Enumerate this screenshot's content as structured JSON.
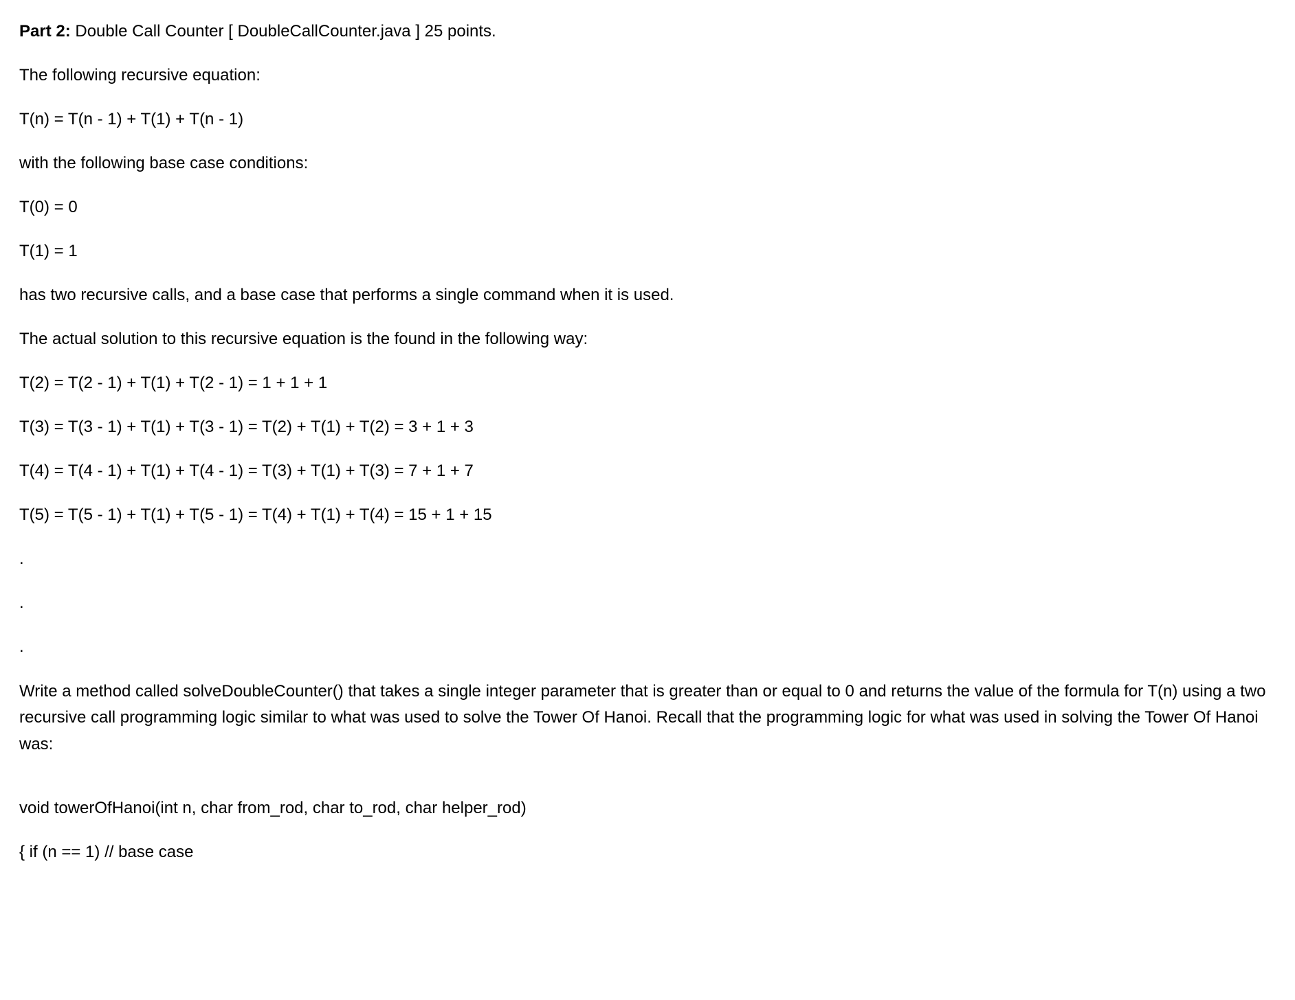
{
  "header": {
    "partLabel": "Part 2:",
    "title": " Double Call Counter [ DoubleCallCounter.java ]  25 points."
  },
  "lines": {
    "intro": "The following recursive equation:",
    "equation": "T(n) = T(n - 1) + T(1) + T(n - 1)",
    "baseCaseIntro": "with the following base case conditions:",
    "base0": "T(0) = 0",
    "base1": "T(1) = 1",
    "description": "has two recursive calls, and a base case that performs a single command when it is used.",
    "solutionIntro": "The actual solution to this recursive equation is the found in the following way:",
    "t2": "T(2) = T(2 - 1) + T(1) + T(2 - 1) = 1 + 1 + 1",
    "t3": "T(3) = T(3 - 1) + T(1) + T(3 - 1) = T(2) + T(1) + T(2) = 3  + 1 + 3",
    "t4": "T(4) = T(4 - 1) + T(1) + T(4 - 1) = T(3) + T(1) + T(3) = 7 + 1 + 7",
    "t5": "T(5) = T(5 - 1) + T(1) + T(5 - 1) = T(4) + T(1) + T(4) = 15 + 1 + 15",
    "dot1": ".",
    "dot2": ".",
    "dot3": ".",
    "task": "Write a method called solveDoubleCounter() that takes a single integer parameter that is greater than or equal to 0 and returns the value of the formula for T(n) using a two recursive call programming logic similar to what was used to solve the Tower Of Hanoi.  Recall that the programming logic for what was used in solving the Tower Of Hanoi was:",
    "code1": "void towerOfHanoi(int n, char from_rod, char to_rod, char helper_rod)",
    "code2": "{ if (n == 1) // base case"
  }
}
